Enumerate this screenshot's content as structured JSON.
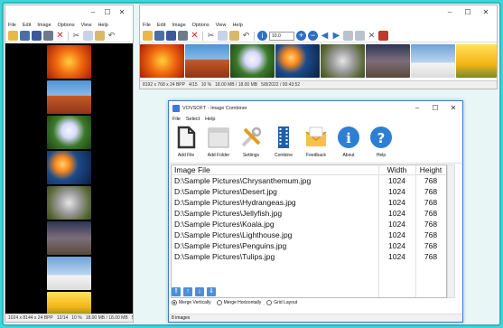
{
  "left_viewer": {
    "menu": [
      "File",
      "Edit",
      "Image",
      "Options",
      "View",
      "Help"
    ],
    "status": [
      "1024 x 8144 x 24 BPP",
      "12/14",
      "10 %",
      "18.00 MB / 18.00 MB",
      "5/"
    ]
  },
  "right_viewer": {
    "menu": [
      "File",
      "Edit",
      "Image",
      "Options",
      "View",
      "Help"
    ],
    "zoom_value": "10.0",
    "status": [
      "8192 x 768 x 24 BPP",
      "4/15",
      "10 %",
      "18.00 MB / 18.00 MB",
      "5/8/2022 / 00:43:52"
    ]
  },
  "dialog": {
    "title": "VOVSOFT - Image Combiner",
    "menu": [
      "File",
      "Select",
      "Help"
    ],
    "tools": [
      "Add File",
      "Add Folder",
      "Settings",
      "Combine",
      "Feedback",
      "About",
      "Help"
    ],
    "columns": [
      "Image File",
      "Width",
      "Height"
    ],
    "rows": [
      [
        "D:\\Sample Pictures\\Chrysanthemum.jpg",
        "1024",
        "768"
      ],
      [
        "D:\\Sample Pictures\\Desert.jpg",
        "1024",
        "768"
      ],
      [
        "D:\\Sample Pictures\\Hydrangeas.jpg",
        "1024",
        "768"
      ],
      [
        "D:\\Sample Pictures\\Jellyfish.jpg",
        "1024",
        "768"
      ],
      [
        "D:\\Sample Pictures\\Koala.jpg",
        "1024",
        "768"
      ],
      [
        "D:\\Sample Pictures\\Lighthouse.jpg",
        "1024",
        "768"
      ],
      [
        "D:\\Sample Pictures\\Penguins.jpg",
        "1024",
        "768"
      ],
      [
        "D:\\Sample Pictures\\Tulips.jpg",
        "1024",
        "768"
      ]
    ],
    "merge_options": [
      "Merge Vertically",
      "Merge Horizontally",
      "Grid Layout"
    ],
    "selected_merge": "Merge Vertically",
    "status": "8 images"
  },
  "colors": {
    "accent_blue": "#3a7bd5",
    "frame_teal": "#2fb8c4",
    "background_teal": "#3fd6d6"
  }
}
